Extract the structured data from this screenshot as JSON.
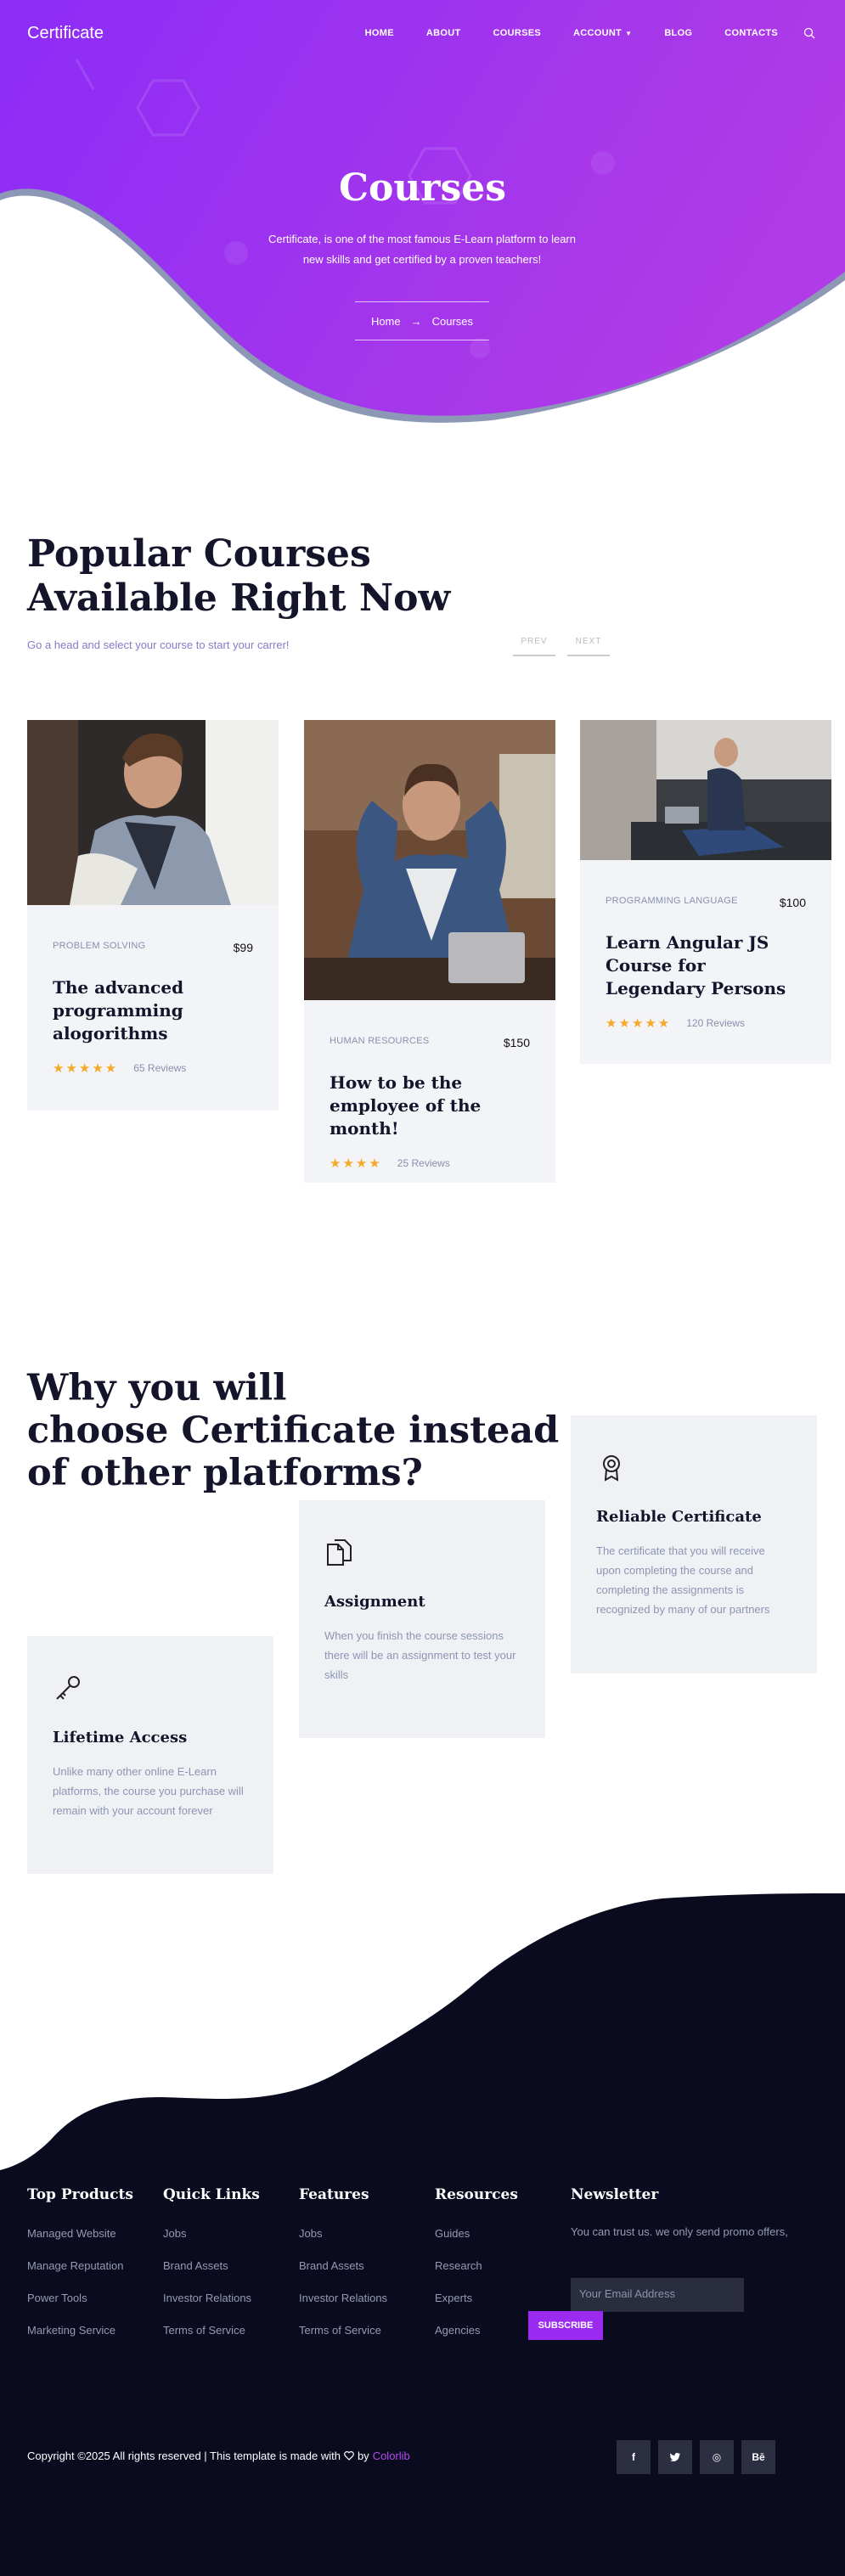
{
  "header": {
    "logo": "Certificate",
    "nav": [
      {
        "label": "HOME"
      },
      {
        "label": "ABOUT"
      },
      {
        "label": "COURSES"
      },
      {
        "label": "ACCOUNT"
      },
      {
        "label": "BLOG"
      },
      {
        "label": "CONTACTS"
      }
    ],
    "search_icon": "search-icon"
  },
  "hero": {
    "title": "Courses",
    "subtitle": "Certificate, is one of the most famous E-Learn platform to learn new skills and get certified by a proven teachers!",
    "breadcrumb": {
      "home": "Home",
      "current": "Courses"
    },
    "colors": {
      "gradient_start": "#8c2cf7",
      "gradient_end": "#b13be6"
    }
  },
  "popular": {
    "title_line1": "Popular Courses",
    "title_line2": "Available Right Now",
    "subtitle": "Go a head and select your course to start your carrer!",
    "prev": "PREV",
    "next": "NEXT",
    "courses": [
      {
        "category": "PROBLEM SOLVING",
        "price": "$99",
        "title": "The advanced programming alogorithms",
        "stars": 5,
        "reviews": "65 Reviews"
      },
      {
        "category": "HUMAN RESOURCES",
        "price": "$150",
        "title": "How to be the employee of the month!",
        "stars": 4,
        "reviews": "25 Reviews"
      },
      {
        "category": "PROGRAMMING LANGUAGE",
        "price": "$100",
        "title": "Learn Angular JS Course for Legendary Persons",
        "stars": 5,
        "reviews": "120 Reviews"
      }
    ]
  },
  "why": {
    "title_line1": "Why you will",
    "title_line2": "choose Certificate instead",
    "title_line3": "of other platforms?",
    "features": [
      {
        "icon": "key-icon",
        "title": "Lifetime Access",
        "text": "Unlike many other online E-Learn platforms, the course you purchase will remain with your account forever"
      },
      {
        "icon": "document-icon",
        "title": "Assignment",
        "text": "When you finish the course sessions there will be an assignment to test your skills"
      },
      {
        "icon": "certificate-badge-icon",
        "title": "Reliable Certificate",
        "text": "The certificate that you will receive upon completing the course and completing the assignments is recognized by many of our partners"
      }
    ]
  },
  "footer": {
    "columns": [
      {
        "title": "Top Products",
        "links": [
          "Managed Website",
          "Manage Reputation",
          "Power Tools",
          "Marketing Service"
        ]
      },
      {
        "title": "Quick Links",
        "links": [
          "Jobs",
          "Brand Assets",
          "Investor Relations",
          "Terms of Service"
        ]
      },
      {
        "title": "Features",
        "links": [
          "Jobs",
          "Brand Assets",
          "Investor Relations",
          "Terms of Service"
        ]
      },
      {
        "title": "Resources",
        "links": [
          "Guides",
          "Research",
          "Experts",
          "Agencies"
        ]
      }
    ],
    "newsletter": {
      "title": "Newsletter",
      "text": "You can trust us. we only send promo offers,",
      "placeholder": "Your Email Address",
      "button": "SUBSCRIBE"
    },
    "copyright_prefix": "Copyright ©2025 All rights reserved | This template is made with",
    "copyright_by": "by",
    "brand": "Colorlib",
    "socials": [
      "f",
      "🐦",
      "◎",
      "Bē"
    ],
    "social_names": [
      "facebook-icon",
      "twitter-icon",
      "dribbble-icon",
      "behance-icon"
    ],
    "colors": {
      "dark_bg": "#0a0b1f",
      "accent": "#9b2bf0"
    }
  }
}
